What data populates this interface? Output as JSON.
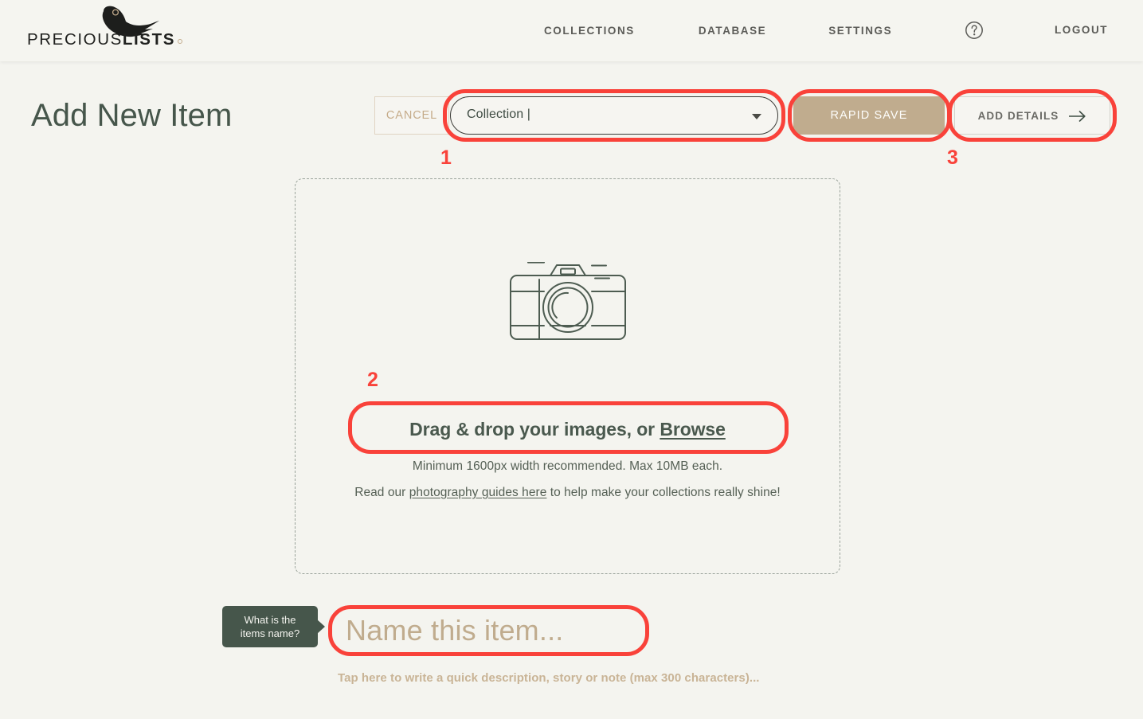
{
  "header": {
    "logo": {
      "text_light": "PRECIOUS",
      "text_bold": "LISTS",
      "icon": "bird-logo-icon"
    },
    "nav": [
      {
        "label": "COLLECTIONS",
        "name": "nav-collections"
      },
      {
        "label": "DATABASE",
        "name": "nav-database"
      },
      {
        "label": "SETTINGS",
        "name": "nav-settings"
      }
    ],
    "help_icon": "question-mark-circle-icon",
    "logout_label": "LOGOUT"
  },
  "main": {
    "page_title": "Add New Item",
    "cancel_label": "CANCEL",
    "collection_select": {
      "value": "Collection |",
      "caret_icon": "chevron-down-icon"
    },
    "rapid_save_label": "RAPID SAVE",
    "add_details_label": "ADD DETAILS",
    "add_details_icon": "arrow-right-icon"
  },
  "dropzone": {
    "camera_icon": "camera-icon",
    "drag_prefix": "Drag & drop your images, or ",
    "browse_label": "Browse",
    "hint_size": "Minimum 1600px width recommended. Max 10MB each.",
    "hint_guides_prefix": "Read our ",
    "hint_guides_link": "photography guides here",
    "hint_guides_suffix": " to help make your collections really shine!"
  },
  "name_row": {
    "tooltip_line1": "What is the",
    "tooltip_line2": "items name?",
    "name_placeholder": "Name this item...",
    "description_placeholder": "Tap here to write a quick description, story or note (max 300 characters)..."
  },
  "annotations": [
    {
      "number": "1",
      "target": "collection-select"
    },
    {
      "number": "2",
      "target": "drag-drop-text"
    },
    {
      "number": "3",
      "target": "add-details-button"
    }
  ],
  "colors": {
    "page_background": "#f4f4ef",
    "header_background": "#f5f5f0",
    "accent_tan": "#c0ac8e",
    "dark_green": "#46564b",
    "annotation_red": "#f9423a"
  }
}
